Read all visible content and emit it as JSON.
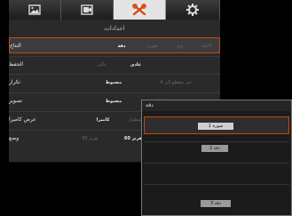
{
  "tabs": [
    {
      "name": "tab-image",
      "icon": "image-icon",
      "active": false
    },
    {
      "name": "tab-video",
      "icon": "video-icon",
      "active": false
    },
    {
      "name": "tab-settings",
      "icon": "tools-icon",
      "active": true
    },
    {
      "name": "tab-gear",
      "icon": "gear-icon",
      "active": false
    }
  ],
  "panel": {
    "title": "اعدادات",
    "rows": [
      {
        "label": "النتاج",
        "options": [
          "كاملة",
          "نوع",
          "صورة",
          "دقة"
        ],
        "active": 3
      },
      {
        "label": "الحفظ",
        "options": [
          "عادي",
          "عالي"
        ],
        "active": 0
      },
      {
        "label": "تكرار",
        "options": [
          "غير متقطع إلى 4",
          "مضبوط"
        ],
        "active": 1
      },
      {
        "label": "تصوير",
        "options": [
          "تسجيل الفيديو",
          "مضبوط"
        ],
        "active": 1
      },
      {
        "label": "عرض كاميرا",
        "options": [
          "المطول",
          "كاميرا"
        ],
        "active": 1
      },
      {
        "label": "وضع",
        "options": [
          "هرتز 50",
          "هرتز 60"
        ],
        "active": 1
      }
    ]
  },
  "popup": {
    "title": "دقة",
    "items": [
      "صورة 1",
      "",
      "دقة 2",
      "",
      "",
      "",
      "دقة 3"
    ],
    "selected": 0
  },
  "colors": {
    "accent": "#c24a17",
    "background": "#000000",
    "panel": "#2a2a2a",
    "tab_active": "#e4e4e4"
  }
}
